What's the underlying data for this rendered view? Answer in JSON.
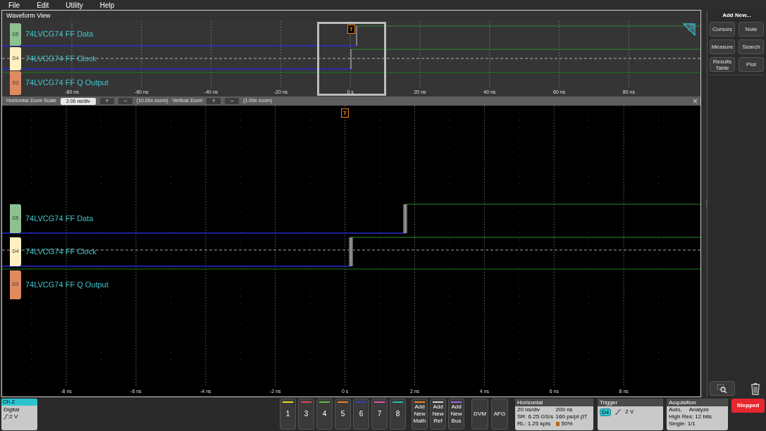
{
  "menu": [
    "File",
    "Edit",
    "Utility",
    "Help"
  ],
  "waveform_view": {
    "title": "Waveform View",
    "overview_channels": [
      {
        "badge": "D5",
        "label": "74LVCG74 FF Data",
        "color": "#8fc08f"
      },
      {
        "badge": "D4",
        "label": "74LVCG74 FF Clock",
        "color": "#fdf0c2"
      },
      {
        "badge": "D3",
        "label": "74LVCG74 FF Q Output",
        "color": "#e08a62"
      }
    ],
    "main_channels": [
      {
        "badge": "D5",
        "label": "74LVCG74 FF Data",
        "color": "#8fc08f"
      },
      {
        "badge": "D4",
        "label": "74LVCG74 FF Clock",
        "color": "#fdf0c2"
      },
      {
        "badge": "D3",
        "label": "74LVCG74 FF Q Output",
        "color": "#e08a62"
      }
    ],
    "overview_ticks": [
      "-80 ns",
      "-60 ns",
      "-40 ns",
      "-20 ns",
      "0 s",
      "20 ns",
      "40 ns",
      "60 ns",
      "80 ns"
    ],
    "overview_trigger_marker": "T",
    "main_trigger_marker": "T",
    "resize_handle": "⋮",
    "zoom_bar": {
      "h_label": "Horizontal Zoom Scale",
      "h_value": "2.00 ns/div",
      "plus": "+",
      "minus": "−",
      "h_zoom": "(10.00x zoom)",
      "v_label": "Vertical Zoom",
      "v_zoom": "(1.00x zoom)",
      "close": "×"
    },
    "main_ticks": [
      "-8 ns",
      "-6 ns",
      "-4 ns",
      "-2 ns",
      "0 s",
      "2 ns",
      "4 ns",
      "6 ns",
      "8 ns"
    ]
  },
  "add_new": {
    "title": "Add New...",
    "buttons": [
      "Cursors",
      "Note",
      "Measure",
      "Search",
      "Results Table",
      "Plot"
    ]
  },
  "channel_badge": {
    "title": "Ch 2",
    "type": "Digital",
    "threshold": ":2 V"
  },
  "channel_buttons": [
    {
      "label": "1",
      "color": "#e8e020"
    },
    {
      "label": "3",
      "color": "#e0405a"
    },
    {
      "label": "4",
      "color": "#60c040"
    },
    {
      "label": "5",
      "color": "#f08020"
    },
    {
      "label": "6",
      "color": "#3040c0"
    },
    {
      "label": "7",
      "color": "#e050a0"
    },
    {
      "label": "8",
      "color": "#20c0a0"
    }
  ],
  "add_buttons": [
    {
      "label": "Add New Math",
      "color": "#f08020"
    },
    {
      "label": "Add New Ref",
      "color": "#d0d0d0"
    },
    {
      "label": "Add New Bus",
      "color": "#a060e0"
    }
  ],
  "tool_buttons": [
    "DVM",
    "AFG"
  ],
  "horizontal": {
    "title": "Horizontal",
    "cells": [
      "20 ns/div",
      "200 ns",
      "SR: 6.25 GS/s",
      "160 ps/pt (IT",
      "RL: 1.25 kpts",
      "50%"
    ]
  },
  "trigger": {
    "title": "Trigger",
    "source": "D4",
    "level": "2 V"
  },
  "acquisition": {
    "title": "Acquisition",
    "cells": [
      "Auto,",
      "Analyze",
      "High Res: 12 bits",
      "Single: 1/1"
    ]
  },
  "run_state": "Stopped"
}
